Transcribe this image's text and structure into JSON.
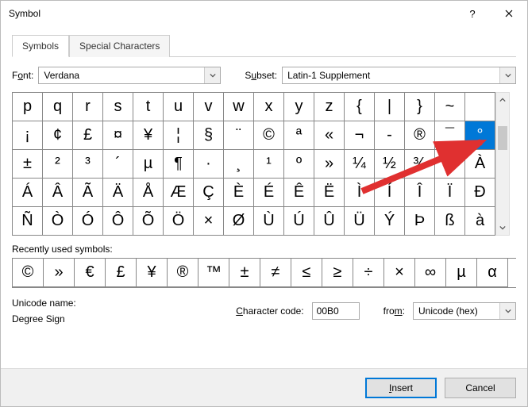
{
  "window": {
    "title": "Symbol"
  },
  "tabs": {
    "symbols": "Symbols",
    "special": "Special Characters"
  },
  "font_label_pre": "F",
  "font_label_u": "o",
  "font_label_post": "nt:",
  "font_value": "Verdana",
  "subset_label_pre": "S",
  "subset_label_u": "u",
  "subset_label_post": "bset:",
  "subset_value": "Latin-1 Supplement",
  "grid": [
    [
      "p",
      "q",
      "r",
      "s",
      "t",
      "u",
      "v",
      "w",
      "x",
      "y",
      "z",
      "{",
      "|",
      "}",
      "~",
      ""
    ],
    [
      "¡",
      "¢",
      "£",
      "¤",
      "¥",
      "¦",
      "§",
      "¨",
      "©",
      "ª",
      "«",
      "¬",
      "-",
      "®",
      "¯",
      "°"
    ],
    [
      "±",
      "²",
      "³",
      "´",
      "µ",
      "¶",
      "·",
      "¸",
      "¹",
      "º",
      "»",
      "¼",
      "½",
      "¾",
      "¿",
      "À"
    ],
    [
      "Á",
      "Â",
      "Ã",
      "Ä",
      "Å",
      "Æ",
      "Ç",
      "È",
      "É",
      "Ê",
      "Ë",
      "Ì",
      "Í",
      "Î",
      "Ï",
      "Ð"
    ],
    [
      "Ñ",
      "Ò",
      "Ó",
      "Ô",
      "Õ",
      "Ö",
      "×",
      "Ø",
      "Ù",
      "Ú",
      "Û",
      "Ü",
      "Ý",
      "Þ",
      "ß",
      "à"
    ]
  ],
  "selected": {
    "row": 1,
    "col": 15
  },
  "recent_label_pre": "",
  "recent_label_u": "R",
  "recent_label_post": "ecently used symbols:",
  "recent": [
    "©",
    "»",
    "€",
    "£",
    "¥",
    "®",
    "™",
    "±",
    "≠",
    "≤",
    "≥",
    "÷",
    "×",
    "∞",
    "µ",
    "α"
  ],
  "uname_label": "Unicode name:",
  "uname_value": "Degree Sign",
  "charcode_label_u": "C",
  "charcode_label_post": "haracter code:",
  "charcode_value": "00B0",
  "from_label_pre": "fro",
  "from_label_u": "m",
  "from_label_post": ":",
  "from_value": "Unicode (hex)",
  "buttons": {
    "insert_u": "I",
    "insert_post": "nsert",
    "cancel": "Cancel"
  }
}
